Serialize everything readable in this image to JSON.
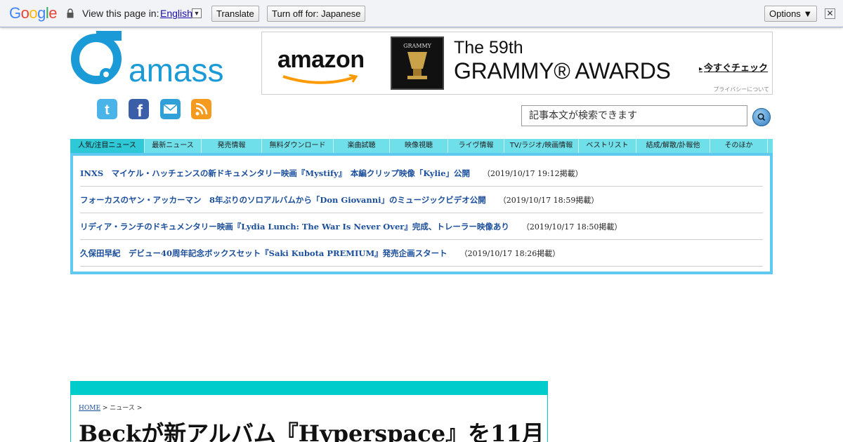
{
  "translate_bar": {
    "logo": "Google",
    "view_text": "View this page in:",
    "language": "English",
    "translate_label": "Translate",
    "turn_off_label": "Turn off for: Japanese",
    "options_label": "Options ▼",
    "close_glyph": "✕"
  },
  "site": {
    "logo_text": "amass",
    "search_placeholder": "記事本文が検索できます"
  },
  "ad": {
    "brand": "amazon",
    "line1": "The 59th",
    "line2": "GRAMMY® AWARDS",
    "cta": "今すぐチェック",
    "privacy": "プライバシーについて",
    "album_label": "GRAMMY"
  },
  "nav": [
    {
      "label": "人気/注目ニュース"
    },
    {
      "label": "最新ニュース"
    },
    {
      "label": "発売情報"
    },
    {
      "label": "無料ダウンロード"
    },
    {
      "label": "楽曲試聴"
    },
    {
      "label": "映像視聴"
    },
    {
      "label": "ライヴ情報"
    },
    {
      "label": "TV/ラジオ/映画情報"
    },
    {
      "label": "ベストリスト"
    },
    {
      "label": "結成/解散/訃報他"
    },
    {
      "label": "そのほか"
    }
  ],
  "news": [
    {
      "title": "INXS　マイケル・ハッチェンスの新ドキュメンタリー映画『Mystify』　本編クリップ映像「Kylie」公開",
      "date": "（2019/10/17 19:12掲載）"
    },
    {
      "title": "フォーカスのヤン・アッカーマン　8年ぶりのソロアルバムから「Don Giovanni」のミュージックビデオ公開",
      "date": "（2019/10/17 18:59掲載）"
    },
    {
      "title": "リディア・ランチのドキュメンタリー映画『Lydia Lunch: The War Is Never Over』完成、トレーラー映像あり",
      "date": "（2019/10/17 18:50掲載）"
    },
    {
      "title": "久保田早紀　デビュー40周年記念ボックスセット『Saki Kubota PREMIUM』発売企画スタート",
      "date": "（2019/10/17 18:26掲載）"
    }
  ],
  "article": {
    "crumb_home": "HOME",
    "crumb_rest": " > ニュース >",
    "headline": "Beckが新アルバム『Hyperspace』を11月"
  }
}
